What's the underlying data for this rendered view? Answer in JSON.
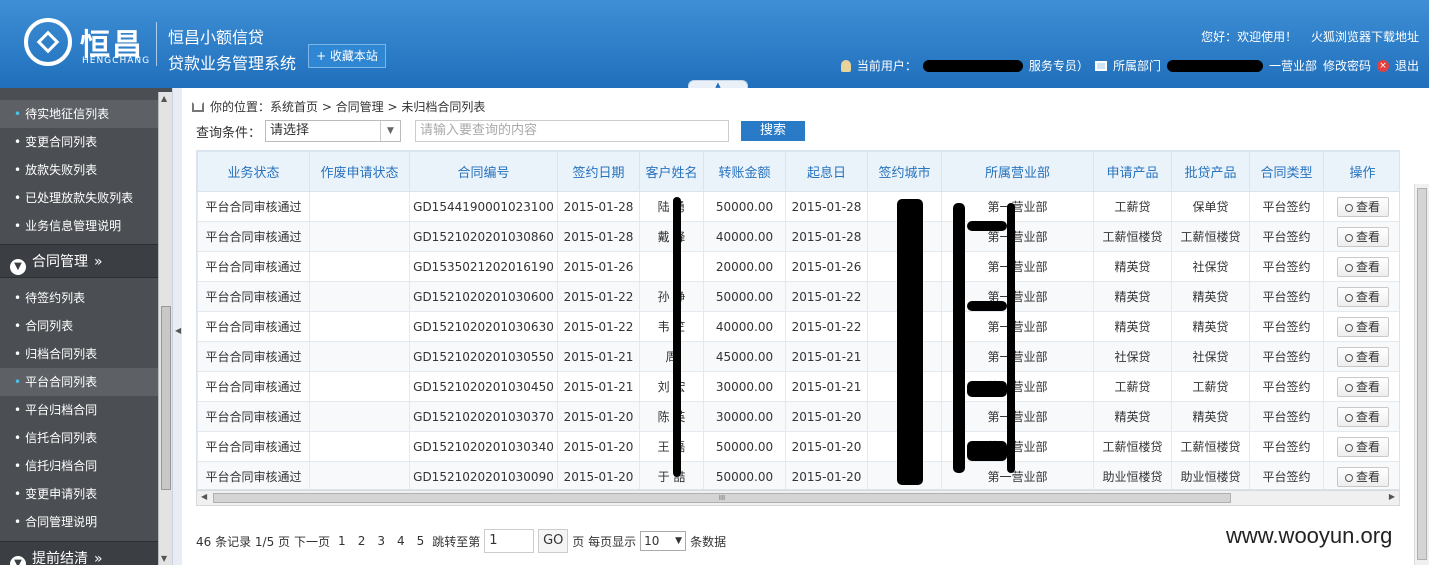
{
  "header": {
    "logo_text": "恒昌",
    "logo_sub": "HENGCHANG",
    "system_line1": "恒昌小额信贷",
    "system_line2": "贷款业务管理系统",
    "bookmark_label": "+ 收藏本站",
    "welcome": "您好：欢迎使用！",
    "browser_download": "火狐浏览器下载地址",
    "current_user_label": "当前用户：",
    "current_user_suffix": "服务专员）",
    "dept_label": "所属部门",
    "dept_suffix": "一营业部",
    "change_password": "修改密码",
    "logout": "退出",
    "collapse_arrow": "▲"
  },
  "sidebar": {
    "items_top": [
      {
        "label": "待实地征信列表",
        "active": true
      },
      {
        "label": "变更合同列表",
        "active": false
      },
      {
        "label": "放款失败列表",
        "active": false
      },
      {
        "label": "已处理放款失败列表",
        "active": false
      },
      {
        "label": "业务信息管理说明",
        "active": false
      }
    ],
    "group1": {
      "label": "合同管理",
      "chevron": "»"
    },
    "items_contract": [
      {
        "label": "待签约列表",
        "active": false
      },
      {
        "label": "合同列表",
        "active": false
      },
      {
        "label": "归档合同列表",
        "active": false
      },
      {
        "label": "平台合同列表",
        "active": true
      },
      {
        "label": "平台归档合同",
        "active": false
      },
      {
        "label": "信托合同列表",
        "active": false
      },
      {
        "label": "信托归档合同",
        "active": false
      },
      {
        "label": "变更申请列表",
        "active": false
      },
      {
        "label": "合同管理说明",
        "active": false
      }
    ],
    "group2": {
      "label": "提前结清",
      "chevron": "»"
    }
  },
  "breadcrumb": "你的位置：系统首页 > 合同管理 > 未归档合同列表",
  "query": {
    "label": "查询条件：",
    "select_value": "请选择",
    "input_placeholder": "请输入要查询的内容",
    "search_button": "搜索"
  },
  "table": {
    "columns": [
      "业务状态",
      "作废申请状态",
      "合同编号",
      "签约日期",
      "客户姓名",
      "转账金额",
      "起息日",
      "签约城市",
      "所属营业部",
      "申请产品",
      "批贷产品",
      "合同类型",
      "操作"
    ],
    "rows": [
      {
        "status": "平台合同审核通过",
        "void_status": "",
        "contract_no": "GD1544190001023100",
        "sign_date": "2015-01-28",
        "customer": "陆 勇",
        "amount": "50000.00",
        "value_date": "2015-01-28",
        "city": "",
        "branch": "第一营业部",
        "apply_product": "工薪贷",
        "approved_product": "保单贷",
        "contract_type": "平台签约",
        "action": "查看"
      },
      {
        "status": "平台合同审核通过",
        "void_status": "",
        "contract_no": "GD1521020201030860",
        "sign_date": "2015-01-28",
        "customer": "戴 峰",
        "amount": "40000.00",
        "value_date": "2015-01-28",
        "city": "",
        "branch": "第一营业部",
        "apply_product": "工薪恒楼贷",
        "approved_product": "工薪恒楼贷",
        "contract_type": "平台签约",
        "action": "查看"
      },
      {
        "status": "平台合同审核通过",
        "void_status": "",
        "contract_no": "GD1535021202016190",
        "sign_date": "2015-01-26",
        "customer": "",
        "amount": "20000.00",
        "value_date": "2015-01-26",
        "city": "",
        "branch": "第一营业部",
        "apply_product": "精英贷",
        "approved_product": "社保贷",
        "contract_type": "平台签约",
        "action": "查看"
      },
      {
        "status": "平台合同审核通过",
        "void_status": "",
        "contract_no": "GD1521020201030600",
        "sign_date": "2015-01-22",
        "customer": "孙 琤",
        "amount": "50000.00",
        "value_date": "2015-01-22",
        "city": "",
        "branch": "第一营业部",
        "apply_product": "精英贷",
        "approved_product": "精英贷",
        "contract_type": "平台签约",
        "action": "查看"
      },
      {
        "status": "平台合同审核通过",
        "void_status": "",
        "contract_no": "GD1521020201030630",
        "sign_date": "2015-01-22",
        "customer": "韦 竺",
        "amount": "40000.00",
        "value_date": "2015-01-22",
        "city": "",
        "branch": "第一营业部",
        "apply_product": "精英贷",
        "approved_product": "精英贷",
        "contract_type": "平台签约",
        "action": "查看"
      },
      {
        "status": "平台合同审核通过",
        "void_status": "",
        "contract_no": "GD1521020201030550",
        "sign_date": "2015-01-21",
        "customer": "周 ",
        "amount": "45000.00",
        "value_date": "2015-01-21",
        "city": "",
        "branch": "第一营业部",
        "apply_product": "社保贷",
        "approved_product": "社保贷",
        "contract_type": "平台签约",
        "action": "查看"
      },
      {
        "status": "平台合同审核通过",
        "void_status": "",
        "contract_no": "GD1521020201030450",
        "sign_date": "2015-01-21",
        "customer": "刘 宏",
        "amount": "30000.00",
        "value_date": "2015-01-21",
        "city": "",
        "branch": "第一营业部",
        "apply_product": "工薪贷",
        "approved_product": "工薪贷",
        "contract_type": "平台签约",
        "action": "查看"
      },
      {
        "status": "平台合同审核通过",
        "void_status": "",
        "contract_no": "GD1521020201030370",
        "sign_date": "2015-01-20",
        "customer": "陈 英",
        "amount": "30000.00",
        "value_date": "2015-01-20",
        "city": "",
        "branch": "第一营业部",
        "apply_product": "精英贷",
        "approved_product": "精英贷",
        "contract_type": "平台签约",
        "action": "查看"
      },
      {
        "status": "平台合同审核通过",
        "void_status": "",
        "contract_no": "GD1521020201030340",
        "sign_date": "2015-01-20",
        "customer": "王 磊",
        "amount": "50000.00",
        "value_date": "2015-01-20",
        "city": "",
        "branch": "第一营业部",
        "apply_product": "工薪恒楼贷",
        "approved_product": "工薪恒楼贷",
        "contract_type": "平台签约",
        "action": "查看"
      },
      {
        "status": "平台合同审核通过",
        "void_status": "",
        "contract_no": "GD1521020201030090",
        "sign_date": "2015-01-20",
        "customer": "于 喆",
        "amount": "50000.00",
        "value_date": "2015-01-20",
        "city": "",
        "branch": "第一营业部",
        "apply_product": "助业恒楼贷",
        "approved_product": "助业恒楼贷",
        "contract_type": "平台签约",
        "action": "查看"
      }
    ],
    "hscroll_grip": "III"
  },
  "pager": {
    "summary": "46 条记录 1/5 页",
    "next": "下一页",
    "pages": [
      "1",
      "2",
      "3",
      "4",
      "5"
    ],
    "goto_label": "跳转至第",
    "goto_value": "1",
    "go_button": "GO",
    "per_page_label": "页 每页显示",
    "per_page_value": "10",
    "per_page_suffix": "条数据"
  },
  "watermark": "www.wooyun.org",
  "colors": {
    "header": "#2a7bc7",
    "sidebar": "#4b4f53",
    "table_header_text": "#2873be"
  }
}
